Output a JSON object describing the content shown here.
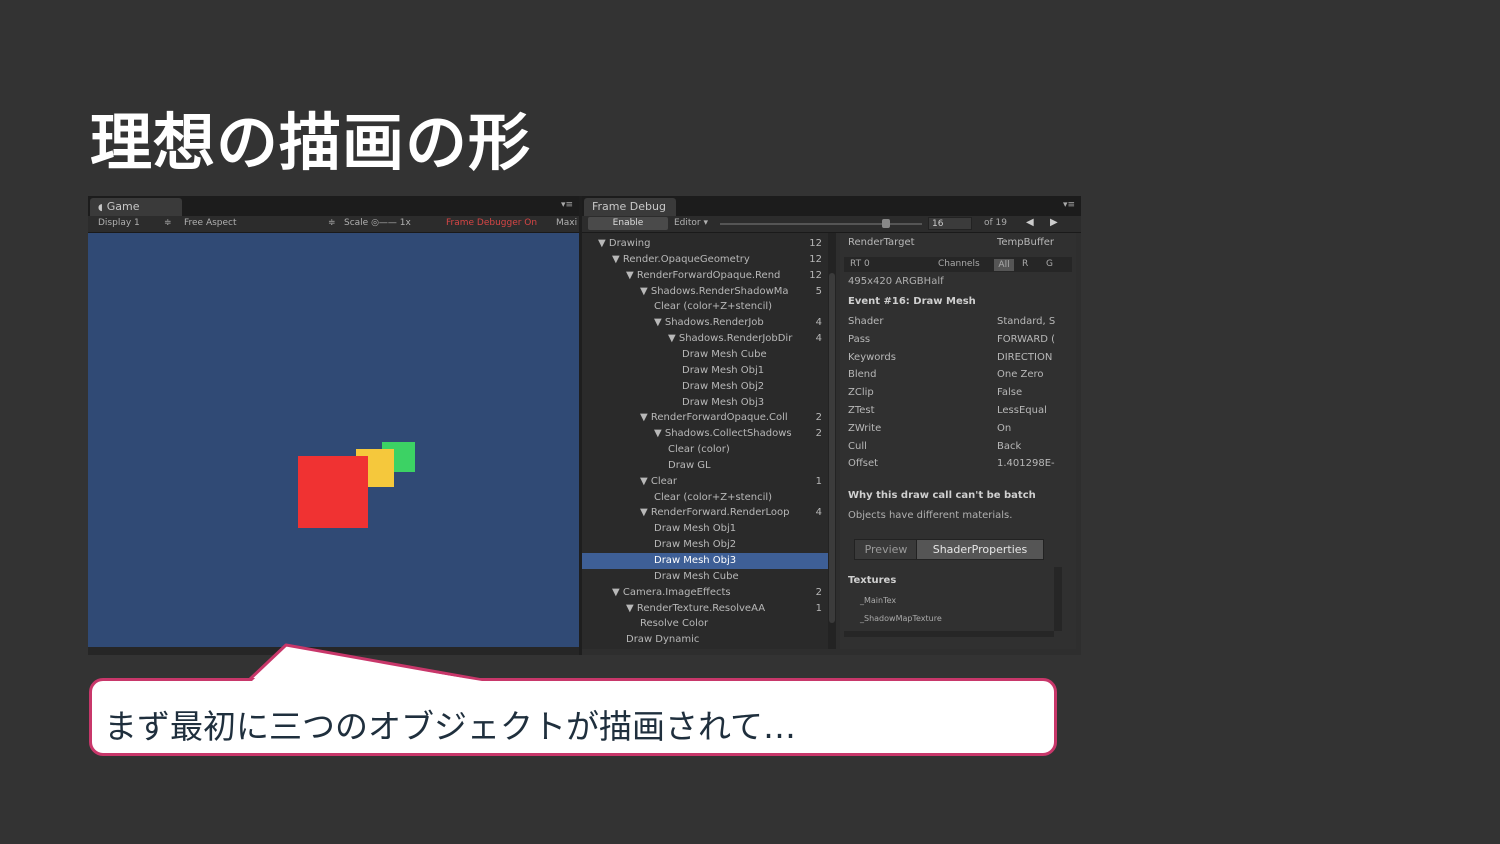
{
  "slide": {
    "title": "理想の描画の形",
    "callout": "まず最初に三つのオブジェクトが描画されて…"
  },
  "colors": {
    "background": "#333333",
    "viewport": "#304a75",
    "callout_border": "#c8376a",
    "selected_row": "#3e5f96",
    "cube_red": "#f03232",
    "cube_yellow": "#f5c83c",
    "cube_green": "#3cd264"
  },
  "game_panel": {
    "tab_label": "Game",
    "display": "Display 1",
    "aspect": "Free Aspect",
    "scale": "Scale ◎—— 1x",
    "debugger_status": "Frame Debugger On",
    "max_btn": "Maxi"
  },
  "frame_debug": {
    "tab_label": "Frame Debug",
    "enable_btn": "Enable",
    "editor_dd": "Editor ▾",
    "frame_number": "16",
    "frame_total": "of 19",
    "tree": [
      {
        "label": "▼ Drawing",
        "count": "12",
        "indent": 0
      },
      {
        "label": "▼ Render.OpaqueGeometry",
        "count": "12",
        "indent": 1
      },
      {
        "label": "▼ RenderForwardOpaque.Rend",
        "count": "12",
        "indent": 2
      },
      {
        "label": "▼ Shadows.RenderShadowMa",
        "count": "5",
        "indent": 3
      },
      {
        "label": "Clear (color+Z+stencil)",
        "count": "",
        "indent": 4
      },
      {
        "label": "▼ Shadows.RenderJob",
        "count": "4",
        "indent": 4
      },
      {
        "label": "▼ Shadows.RenderJobDir",
        "count": "4",
        "indent": 5
      },
      {
        "label": "Draw Mesh Cube",
        "count": "",
        "indent": 6
      },
      {
        "label": "Draw Mesh Obj1",
        "count": "",
        "indent": 6
      },
      {
        "label": "Draw Mesh Obj2",
        "count": "",
        "indent": 6
      },
      {
        "label": "Draw Mesh Obj3",
        "count": "",
        "indent": 6
      },
      {
        "label": "▼ RenderForwardOpaque.Coll",
        "count": "2",
        "indent": 3
      },
      {
        "label": "▼ Shadows.CollectShadows",
        "count": "2",
        "indent": 4
      },
      {
        "label": "Clear (color)",
        "count": "",
        "indent": 5
      },
      {
        "label": "Draw GL",
        "count": "",
        "indent": 5
      },
      {
        "label": "▼ Clear",
        "count": "1",
        "indent": 3
      },
      {
        "label": "Clear (color+Z+stencil)",
        "count": "",
        "indent": 4
      },
      {
        "label": "▼ RenderForward.RenderLoop",
        "count": "4",
        "indent": 3
      },
      {
        "label": "Draw Mesh Obj1",
        "count": "",
        "indent": 4
      },
      {
        "label": "Draw Mesh Obj2",
        "count": "",
        "indent": 4
      },
      {
        "label": "Draw Mesh Obj3",
        "count": "",
        "indent": 4,
        "selected": true
      },
      {
        "label": "Draw Mesh Cube",
        "count": "",
        "indent": 4
      },
      {
        "label": "▼ Camera.ImageEffects",
        "count": "2",
        "indent": 1
      },
      {
        "label": "▼ RenderTexture.ResolveAA",
        "count": "1",
        "indent": 2
      },
      {
        "label": "Resolve Color",
        "count": "",
        "indent": 3
      },
      {
        "label": "Draw Dynamic",
        "count": "",
        "indent": 2
      }
    ],
    "details": {
      "render_target_label": "RenderTarget",
      "render_target_value": "TempBuffer",
      "rt_left": "RT 0",
      "channels_label": "Channels",
      "channels_all": "All",
      "channels_r": "R",
      "channels_g": "G",
      "format": "495x420 ARGBHalf",
      "event_title": "Event #16: Draw Mesh",
      "props": [
        {
          "k": "Shader",
          "v": "Standard, S"
        },
        {
          "k": "Pass",
          "v": "FORWARD ("
        },
        {
          "k": "Keywords",
          "v": "DIRECTION"
        },
        {
          "k": "Blend",
          "v": "One Zero"
        },
        {
          "k": "ZClip",
          "v": "False"
        },
        {
          "k": "ZTest",
          "v": "LessEqual"
        },
        {
          "k": "ZWrite",
          "v": "On"
        },
        {
          "k": "Cull",
          "v": "Back"
        },
        {
          "k": "Offset",
          "v": "1.401298E-"
        }
      ],
      "batch_title": "Why this draw call can't be batch",
      "batch_reason": "Objects have different materials.",
      "tab_preview": "Preview",
      "tab_shader_props": "ShaderProperties",
      "textures_title": "Textures",
      "textures": [
        "_MainTex",
        "_ShadowMapTexture"
      ]
    }
  }
}
